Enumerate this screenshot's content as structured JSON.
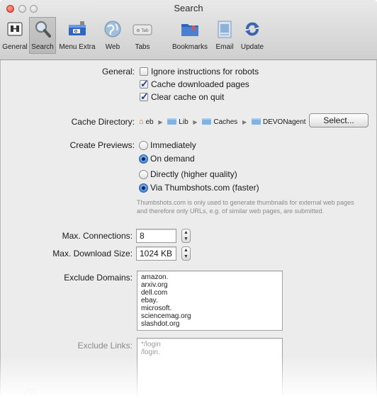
{
  "window": {
    "title": "Search"
  },
  "toolbar": {
    "items": [
      {
        "label": "General",
        "icon": "switch-panel-icon"
      },
      {
        "label": "Search",
        "icon": "magnifier-icon"
      },
      {
        "label": "Menu Extra",
        "icon": "menu-bar-icon"
      },
      {
        "label": "Web",
        "icon": "globe-icon"
      },
      {
        "label": "Tabs",
        "icon": "tabs-icon",
        "icon_text": "⚙ Tab"
      },
      {
        "label": "Bookmarks",
        "icon": "bookmarks-folder-icon"
      },
      {
        "label": "Email",
        "icon": "email-icon"
      },
      {
        "label": "Update",
        "icon": "update-icon"
      }
    ],
    "selected": "Search"
  },
  "general": {
    "label": "General:",
    "options": [
      {
        "label": "Ignore instructions for robots",
        "checked": false
      },
      {
        "label": "Cache downloaded pages",
        "checked": true
      },
      {
        "label": "Clear cache on quit",
        "checked": true
      }
    ]
  },
  "cache_directory": {
    "label": "Cache Directory:",
    "path": [
      "eb",
      "Lib",
      "Caches",
      "DEVONagent"
    ],
    "button": "Select..."
  },
  "create_previews": {
    "label": "Create Previews:",
    "options_a": [
      {
        "label": "Immediately",
        "selected": false
      },
      {
        "label": "On demand",
        "selected": true
      }
    ],
    "options_b": [
      {
        "label": "Directly (higher quality)",
        "selected": false
      },
      {
        "label": "Via Thumbshots.com (faster)",
        "selected": true
      }
    ],
    "note": "Thumbshots.com is only used to generate thumbnails for external web pages and therefore only URLs, e.g. of similar web pages, are submitted."
  },
  "max_connections": {
    "label": "Max. Connections:",
    "value": "8"
  },
  "max_download_size": {
    "label": "Max. Download Size:",
    "value": "1024 KB"
  },
  "exclude_domains": {
    "label": "Exclude Domains:",
    "items": [
      "amazon.",
      "arxiv.org",
      "dell.com",
      "ebay.",
      "microsoft.",
      "sciencemag.org",
      "slashdot.org"
    ]
  },
  "exclude_links": {
    "label": "Exclude Links:",
    "items": [
      "*/login",
      "/login."
    ]
  },
  "help": {
    "label": "?"
  },
  "colors": {
    "accent": "#2b75d6",
    "folder": "#7eb3e3",
    "window_bg": "#ececec"
  }
}
